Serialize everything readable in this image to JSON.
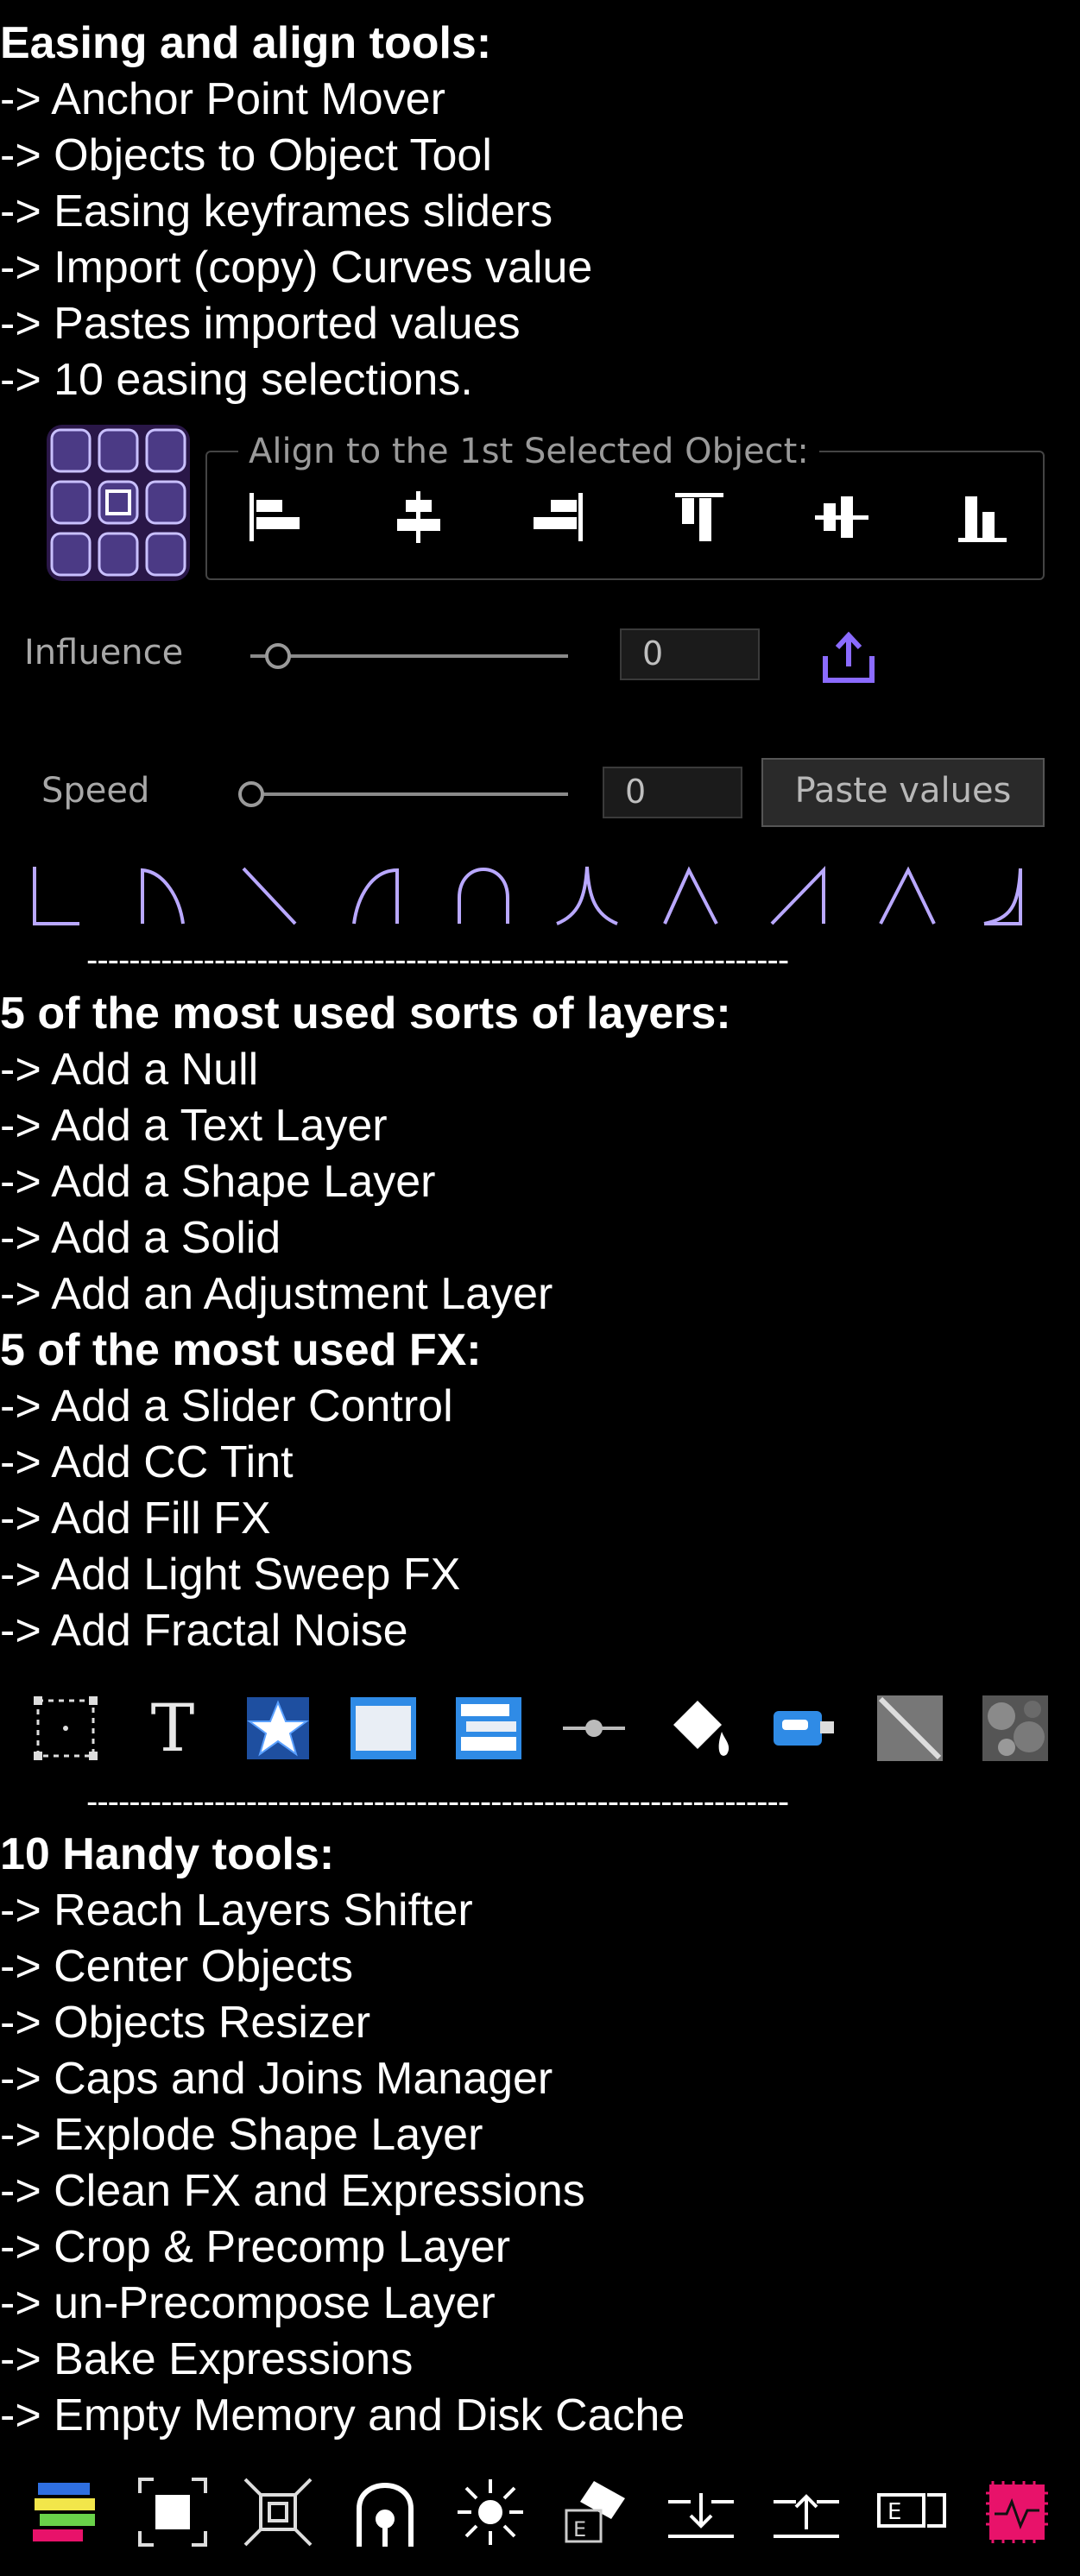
{
  "easing": {
    "heading": "Easing and align tools:",
    "items": [
      "-> Anchor Point Mover",
      "-> Objects to Object Tool",
      "-> Easing keyframes sliders",
      "-> Import (copy) Curves value",
      "-> Pastes imported values",
      "-> 10 easing selections."
    ]
  },
  "align_panel": {
    "title": "Align to the 1st Selected Object:",
    "influence_label": "Influence",
    "influence_value": "0",
    "speed_label": "Speed",
    "speed_value": "0",
    "paste_button": "Paste values"
  },
  "separator": "------------------------------------------------------------------",
  "layers": {
    "heading": "5 of the most used sorts of layers:",
    "items": [
      "-> Add a Null",
      "-> Add a Text Layer",
      "-> Add a Shape Layer",
      "-> Add a Solid",
      "-> Add an Adjustment Layer"
    ]
  },
  "fx": {
    "heading": "5 of the most used FX:",
    "items": [
      "-> Add a Slider Control",
      "-> Add CC Tint",
      "-> Add Fill FX",
      "-> Add Light Sweep FX",
      "-> Add Fractal Noise"
    ]
  },
  "tools": {
    "heading": "10 Handy tools:",
    "items": [
      "-> Reach Layers Shifter",
      "-> Center Objects",
      "-> Objects Resizer",
      "-> Caps and Joins Manager",
      "-> Explode Shape Layer",
      "-> Clean FX and Expressions",
      "-> Crop & Precomp Layer",
      "-> un-Precompose Layer",
      "-> Bake Expressions",
      "-> Empty Memory and Disk Cache"
    ]
  },
  "text_icon_glyph": "T",
  "colors": {
    "accent_purple": "#7a5cff",
    "blue": "#2f8be6",
    "pink": "#e8126a"
  }
}
